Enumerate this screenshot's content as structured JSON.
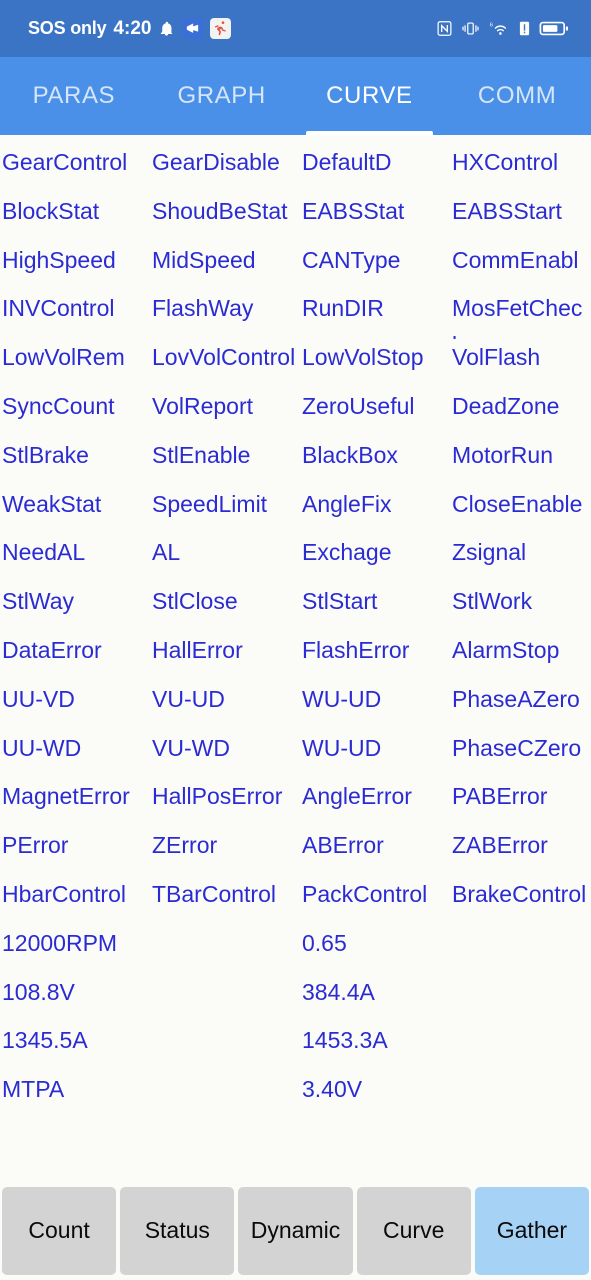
{
  "statusbar": {
    "carrier": "SOS only",
    "clock": "4:20",
    "icons_left": [
      "bell-icon",
      "app-blue-icon",
      "app-runner-icon"
    ],
    "icons_right": [
      "nfc-icon",
      "vibrate-icon",
      "wifi6-icon",
      "sim-alert-icon",
      "battery-icon"
    ],
    "background": "#3b74c4"
  },
  "tabs": [
    {
      "label": "PARAS",
      "active": false
    },
    {
      "label": "GRAPH",
      "active": false
    },
    {
      "label": "CURVE",
      "active": true
    },
    {
      "label": "COMM",
      "active": false
    }
  ],
  "theme": {
    "tabbar_bg": "#4a90e8",
    "page_bg": "#fbfbf8",
    "item_text": "#2b2bd4",
    "button_bg": "#d3d3d3",
    "button_selected_bg": "#a6d2f5"
  },
  "grid": {
    "rows": [
      [
        "GearControl",
        "GearDisable",
        "DefaultD",
        "HXControl"
      ],
      [
        "BlockStat",
        "ShoudBeStat",
        "EABSStat",
        "EABSStart"
      ],
      [
        "HighSpeed",
        "MidSpeed",
        "CANType",
        "CommEnable"
      ],
      [
        "INVControl",
        "FlashWay",
        "RunDIR",
        "MosFetCheck"
      ],
      [
        "LowVolRem",
        "LovVolControl",
        "LowVolStop",
        "VolFlash"
      ],
      [
        "SyncCount",
        "VolReport",
        "ZeroUseful",
        "DeadZone"
      ],
      [
        "StlBrake",
        "StlEnable",
        "BlackBox",
        "MotorRun"
      ],
      [
        "WeakStat",
        "SpeedLimit",
        "AngleFix",
        "CloseEnable"
      ],
      [
        "NeedAL",
        "AL",
        "Exchage",
        "Zsignal"
      ],
      [
        "StlWay",
        "StlClose",
        "StlStart",
        "StlWork"
      ],
      [
        "DataError",
        "HallError",
        "FlashError",
        "AlarmStop"
      ],
      [
        "UU-VD",
        "VU-UD",
        "WU-UD",
        "PhaseAZero"
      ],
      [
        "UU-WD",
        "VU-WD",
        "WU-UD",
        "PhaseCZero"
      ],
      [
        "MagnetError",
        "HallPosError",
        "AngleError",
        "PABError"
      ],
      [
        "PError",
        "ZError",
        "ABError",
        "ZABError"
      ],
      [
        "HbarControl",
        "TBarControl",
        "PackControl",
        "BrakeControl"
      ]
    ],
    "value_rows": [
      [
        "12000RPM",
        "0.65"
      ],
      [
        "108.8V",
        "384.4A"
      ],
      [
        "1345.5A",
        "1453.3A"
      ],
      [
        "MTPA",
        "3.40V"
      ]
    ]
  },
  "bottom_buttons": [
    {
      "label": "Count",
      "selected": false
    },
    {
      "label": "Status",
      "selected": false
    },
    {
      "label": "Dynamic",
      "selected": false
    },
    {
      "label": "Curve",
      "selected": false
    },
    {
      "label": "Gather",
      "selected": true
    }
  ]
}
